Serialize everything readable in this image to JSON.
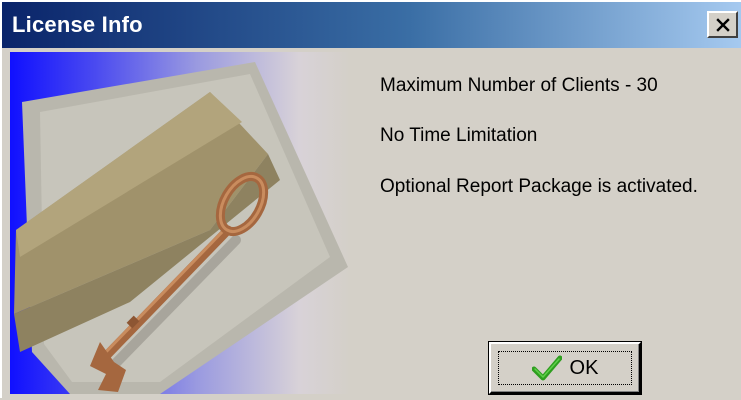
{
  "window": {
    "title": "License Info",
    "close_symbol": "x"
  },
  "info": {
    "lines": [
      "Maximum Number of Clients - 30",
      "No Time Limitation",
      "Optional Report Package is activated."
    ]
  },
  "buttons": {
    "ok_label": "OK"
  },
  "icons": {
    "close": "close-icon",
    "ok": "checkmark-icon",
    "picture": "key-envelope-illustration"
  },
  "colors": {
    "titlebar_start": "#0a246a",
    "titlebar_end": "#a6caf0",
    "dialog_face": "#d4d0c8",
    "checkmark": "#2e9e1f"
  }
}
